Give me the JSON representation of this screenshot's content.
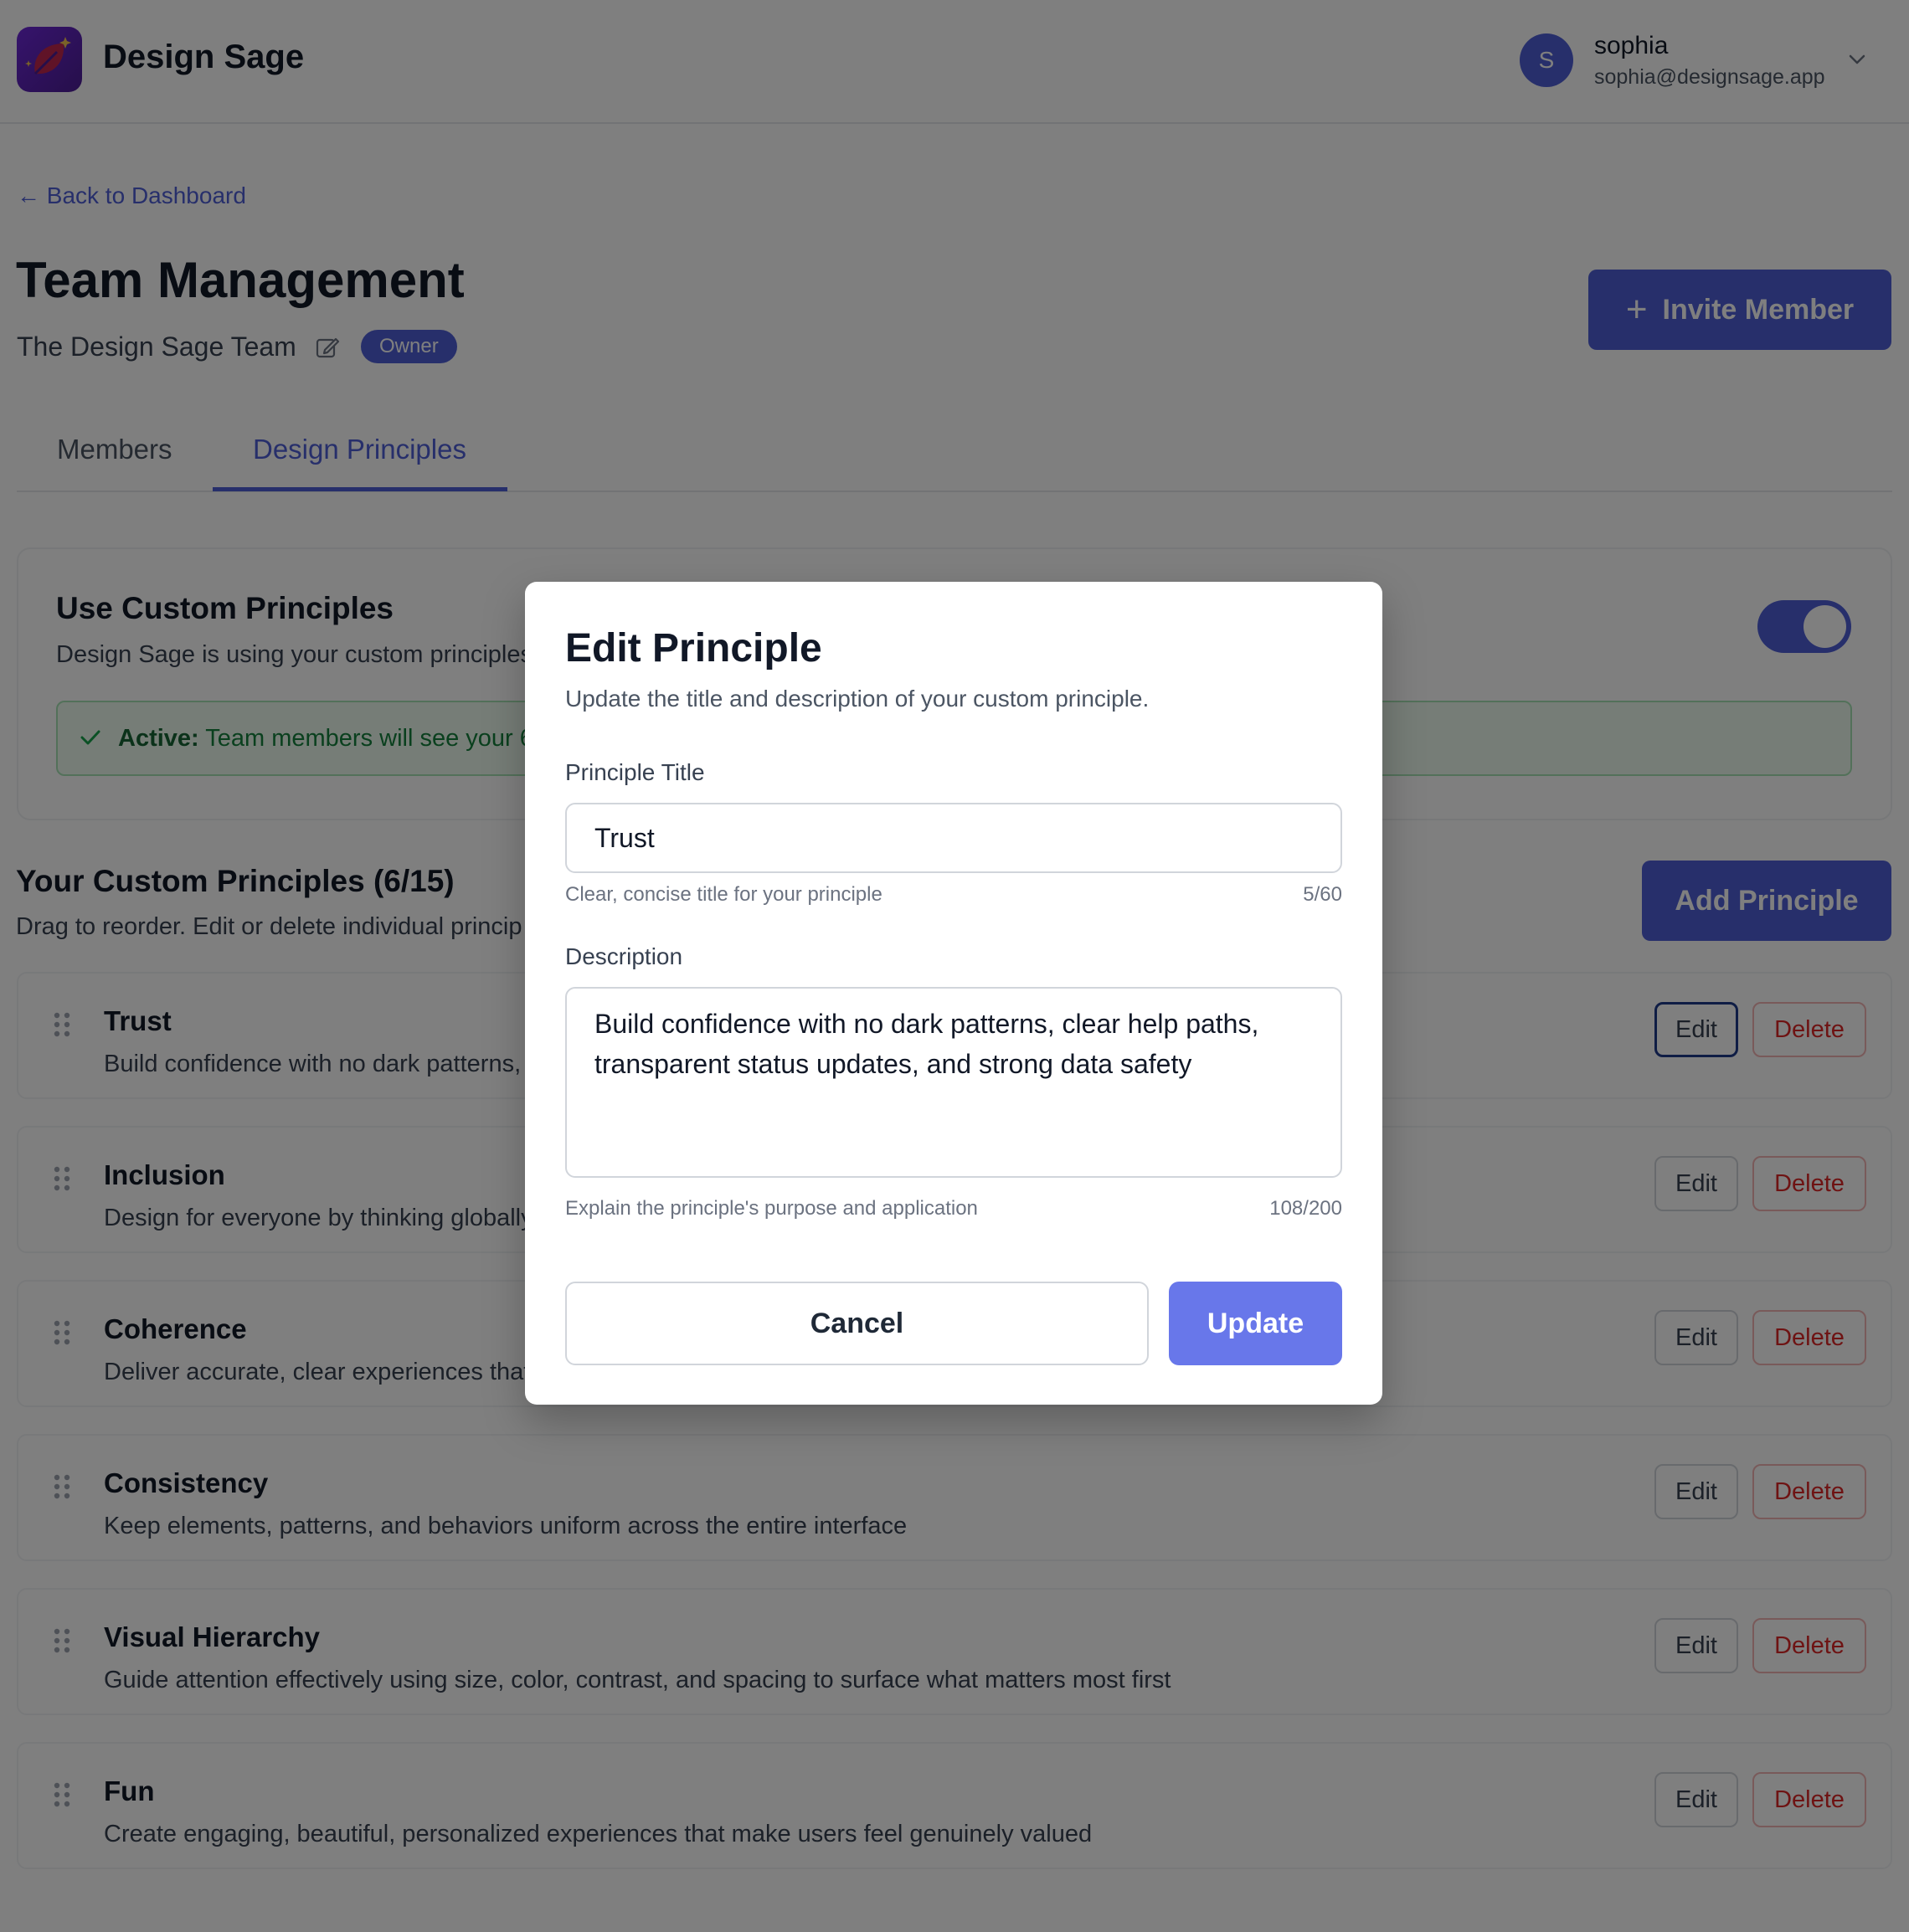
{
  "app": {
    "name": "Design Sage"
  },
  "user": {
    "initial": "S",
    "name": "sophia",
    "email": "sophia@designsage.app"
  },
  "page": {
    "back_link": "← Back to Dashboard",
    "title": "Team Management",
    "team_name": "The Design Sage Team",
    "role_badge": "Owner",
    "invite_button": "Invite Member",
    "invite_icon": "+"
  },
  "tabs": [
    {
      "label": "Members",
      "active": false
    },
    {
      "label": "Design Principles",
      "active": true
    }
  ],
  "custom_toggle": {
    "title": "Use Custom Principles",
    "description": "Design Sage is using your custom principles",
    "enabled": true,
    "banner_strong": "Active:",
    "banner_text": " Team members will see your 6"
  },
  "principles_section": {
    "title": "Your Custom Principles (6/15)",
    "subtitle": "Drag to reorder. Edit or delete individual princip",
    "add_button": "Add Principle",
    "edit_label": "Edit",
    "delete_label": "Delete",
    "items": [
      {
        "title": "Trust",
        "description": "Build confidence with no dark patterns,"
      },
      {
        "title": "Inclusion",
        "description": "Design for everyone by thinking globally"
      },
      {
        "title": "Coherence",
        "description": "Deliver accurate, clear experiences that"
      },
      {
        "title": "Consistency",
        "description": "Keep elements, patterns, and behaviors uniform across the entire interface"
      },
      {
        "title": "Visual Hierarchy",
        "description": "Guide attention effectively using size, color, contrast, and spacing to surface what matters most first"
      },
      {
        "title": "Fun",
        "description": "Create engaging, beautiful, personalized experiences that make users feel genuinely valued"
      }
    ]
  },
  "modal": {
    "title": "Edit Principle",
    "subtitle": "Update the title and description of your custom principle.",
    "title_label": "Principle Title",
    "title_value": "Trust",
    "title_hint": "Clear, concise title for your principle",
    "title_count": "5/60",
    "description_label": "Description",
    "description_value": "Build confidence with no dark patterns, clear help paths, transparent status updates, and strong data safety",
    "description_hint": "Explain the principle's purpose and application",
    "description_count": "108/200",
    "cancel_button": "Cancel",
    "update_button": "Update"
  },
  "colors": {
    "accent": "#4f5fd6",
    "update_button": "#6877ea",
    "danger": "#dc2626",
    "success": "#15803d"
  },
  "icons": [
    "leaf-logo-icon",
    "chevron-down-icon",
    "pencil-square-icon",
    "plus-icon",
    "check-icon",
    "drag-handle-icon"
  ]
}
